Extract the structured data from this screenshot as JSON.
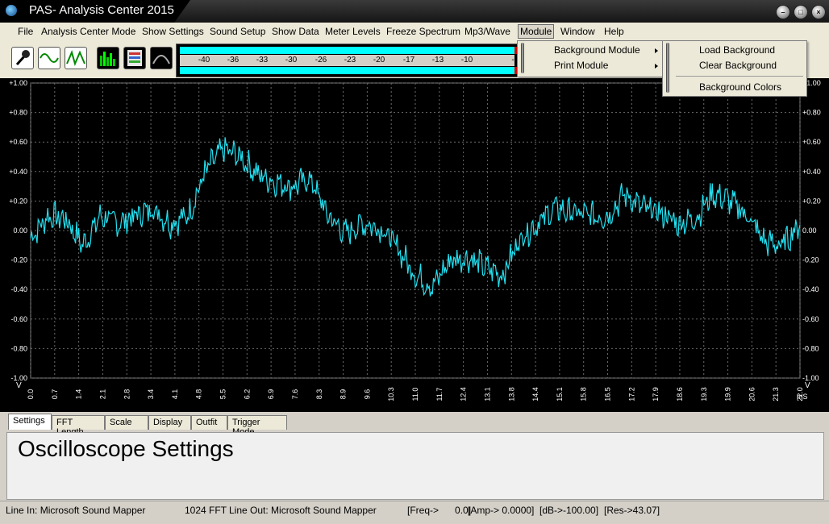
{
  "window": {
    "title": "PAS- Analysis Center 2015",
    "controls": [
      "minimize",
      "maximize",
      "close"
    ]
  },
  "menubar": {
    "items": [
      "File",
      "Analysis Center Mode",
      "Show Settings",
      "Sound Setup",
      "Show Data",
      "Meter Levels",
      "Freeze Spectrum",
      "Mp3/Wave",
      "Module",
      "Window",
      "Help"
    ],
    "active": "Module"
  },
  "module_menu": {
    "items": [
      "Background Module",
      "Print Module"
    ]
  },
  "background_submenu": {
    "items": [
      "Load Background",
      "Clear Background",
      "Background Colors"
    ]
  },
  "toolbar": {
    "buttons": [
      "microphone-icon",
      "sine-wave-icon",
      "square-wave-icon",
      "spectrum-icon",
      "data-icon",
      "envelope-icon"
    ]
  },
  "level_meter": {
    "scale": [
      "-40",
      "-36",
      "-33",
      "-30",
      "-26",
      "-23",
      "-20",
      "-17",
      "-13",
      "-10",
      "-"
    ],
    "colors": {
      "bar": "#00ffff",
      "peak": "#e00000"
    }
  },
  "scope": {
    "y_unit": "V",
    "x_unit": "mS",
    "y_labels": [
      "+1.00",
      "+0.80",
      "+0.60",
      "+0.40",
      "+0.20",
      "0.00",
      "-0.20",
      "-0.40",
      "-0.60",
      "-0.80",
      "-1.00"
    ],
    "x_labels": [
      "0.0",
      "0.7",
      "1.4",
      "2.1",
      "2.8",
      "3.4",
      "4.1",
      "4.8",
      "5.5",
      "6.2",
      "6.9",
      "7.6",
      "8.3",
      "8.9",
      "9.6",
      "10.3",
      "11.0",
      "11.7",
      "12.4",
      "13.1",
      "13.8",
      "14.4",
      "15.1",
      "15.8",
      "16.5",
      "17.2",
      "17.9",
      "18.6",
      "19.3",
      "19.9",
      "20.6",
      "21.3",
      "22.0"
    ],
    "colors": {
      "trace": "#22e0f0",
      "grid": "#6a6a6a",
      "background": "#000000",
      "labels": "#ffffff"
    }
  },
  "chart_data": {
    "type": "line",
    "xlabel": "mS",
    "ylabel": "V",
    "xlim": [
      0,
      22.0
    ],
    "ylim": [
      -1.0,
      1.0
    ],
    "grid": true,
    "series": [
      {
        "x": [
          0.0,
          0.5,
          1.0,
          1.5,
          2.0,
          2.5,
          3.0,
          3.5,
          4.0,
          4.5,
          5.0,
          5.5,
          6.0,
          6.5,
          7.0,
          7.5,
          8.0,
          8.5,
          9.0,
          9.5,
          10.0,
          10.5,
          11.0,
          11.5,
          12.0,
          12.5,
          13.0,
          13.5,
          14.0,
          14.5,
          15.0,
          15.5,
          16.0,
          16.5,
          17.0,
          17.5,
          18.0,
          18.5,
          19.0,
          19.5,
          20.0,
          20.5,
          21.0,
          21.5,
          22.0
        ],
        "y": [
          -0.05,
          0.1,
          0.08,
          -0.1,
          0.1,
          0.05,
          0.1,
          0.15,
          0.05,
          0.1,
          0.4,
          0.55,
          0.5,
          0.38,
          0.33,
          0.3,
          0.35,
          0.1,
          -0.02,
          0.05,
          0.02,
          -0.12,
          -0.3,
          -0.38,
          -0.2,
          -0.18,
          -0.25,
          -0.3,
          -0.05,
          0.05,
          0.15,
          0.12,
          0.1,
          0.1,
          0.25,
          0.15,
          0.12,
          0.05,
          0.08,
          0.25,
          0.2,
          0.1,
          -0.08,
          -0.1,
          0.05
        ]
      }
    ]
  },
  "tabs": {
    "items": [
      "Settings",
      "FFT Length",
      "Scale",
      "Display",
      "Outfit",
      "Trigger Mode"
    ],
    "active": "Settings"
  },
  "panel": {
    "title": "Oscilloscope Settings"
  },
  "status": {
    "line_in": "Line In: Microsoft Sound Mapper",
    "fft": "1024 FFT",
    "line_out": "Line Out: Microsoft Sound Mapper",
    "freq": "[Freq->      0.0]",
    "amp": "[Amp-> 0.0000]",
    "db": "[dB->-100.00]",
    "res": "[Res->43.07]"
  }
}
